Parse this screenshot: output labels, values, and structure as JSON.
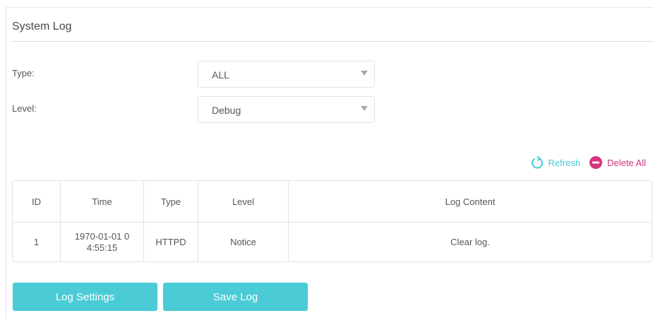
{
  "section": {
    "title": "System Log"
  },
  "filters": {
    "type_label": "Type:",
    "type_value": "ALL",
    "level_label": "Level:",
    "level_value": "Debug"
  },
  "actions": {
    "refresh_label": "Refresh",
    "delete_all_label": "Delete All"
  },
  "table": {
    "headers": [
      "ID",
      "Time",
      "Type",
      "Level",
      "Log Content"
    ],
    "rows": [
      {
        "id": "1",
        "time_line1": "1970-01-01 0",
        "time_line2": "4:55:15",
        "type": "HTTPD",
        "level": "Notice",
        "content": "Clear log."
      }
    ]
  },
  "buttons": {
    "log_settings_label": "Log Settings",
    "save_log_label": "Save Log"
  },
  "colors": {
    "accent": "#4acbd6",
    "delete": "#d6337f"
  }
}
